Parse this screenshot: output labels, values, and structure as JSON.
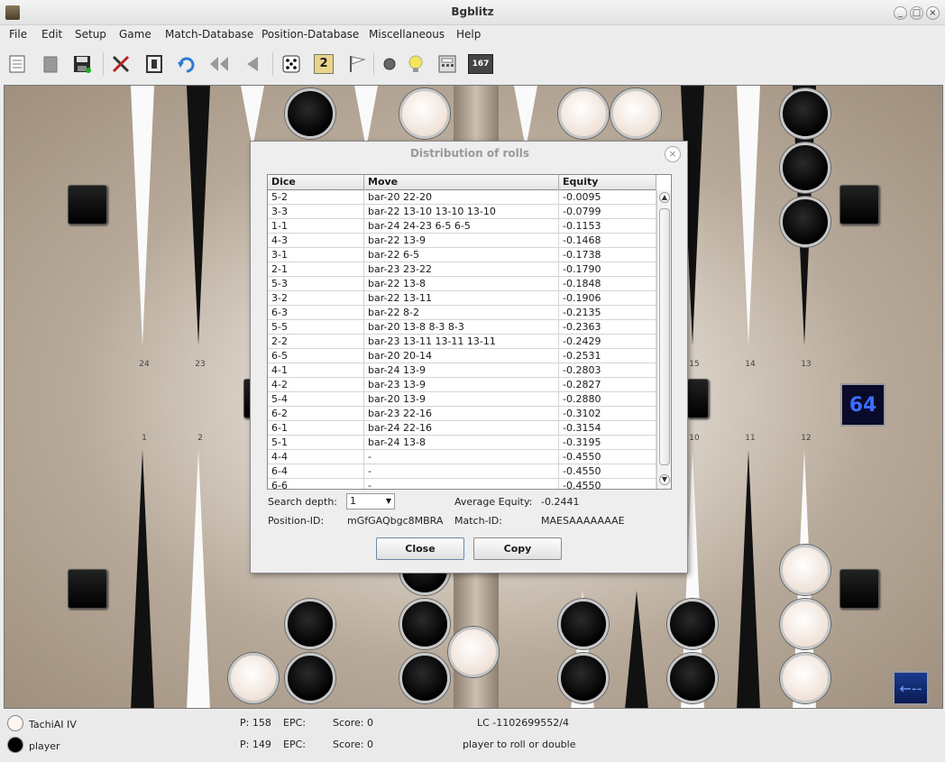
{
  "window": {
    "title": "Bgblitz",
    "minimize": "_",
    "maximize": "□",
    "close": "×"
  },
  "menu": [
    "File",
    "Edit",
    "Setup",
    "Game",
    "Match-Database",
    "Position-Database",
    "Miscellaneous",
    "Help"
  ],
  "toolbar": {
    "dice_value": "2",
    "counter": "167"
  },
  "board": {
    "top_point_labels": [
      "24",
      "23",
      "15",
      "14",
      "13"
    ],
    "bottom_point_labels": [
      "1",
      "2",
      "10",
      "11",
      "12"
    ],
    "cube_value": "64",
    "arrow_label": "←--"
  },
  "dialog": {
    "title": "Distribution of rolls",
    "columns": [
      "Dice",
      "Move",
      "Equity"
    ],
    "rows": [
      [
        "5-2",
        "bar-20 22-20",
        "-0.0095"
      ],
      [
        "3-3",
        "bar-22 13-10 13-10 13-10",
        "-0.0799"
      ],
      [
        "1-1",
        "bar-24 24-23 6-5 6-5",
        "-0.1153"
      ],
      [
        "4-3",
        "bar-22 13-9",
        "-0.1468"
      ],
      [
        "3-1",
        "bar-22 6-5",
        "-0.1738"
      ],
      [
        "2-1",
        "bar-23 23-22",
        "-0.1790"
      ],
      [
        "5-3",
        "bar-22 13-8",
        "-0.1848"
      ],
      [
        "3-2",
        "bar-22 13-11",
        "-0.1906"
      ],
      [
        "6-3",
        "bar-22 8-2",
        "-0.2135"
      ],
      [
        "5-5",
        "bar-20 13-8 8-3 8-3",
        "-0.2363"
      ],
      [
        "2-2",
        "bar-23 13-11 13-11 13-11",
        "-0.2429"
      ],
      [
        "6-5",
        "bar-20 20-14",
        "-0.2531"
      ],
      [
        "4-1",
        "bar-24 13-9",
        "-0.2803"
      ],
      [
        "4-2",
        "bar-23 13-9",
        "-0.2827"
      ],
      [
        "5-4",
        "bar-20 13-9",
        "-0.2880"
      ],
      [
        "6-2",
        "bar-23 22-16",
        "-0.3102"
      ],
      [
        "6-1",
        "bar-24 22-16",
        "-0.3154"
      ],
      [
        "5-1",
        "bar-24 13-8",
        "-0.3195"
      ],
      [
        "4-4",
        "-",
        "-0.4550"
      ],
      [
        "6-4",
        "-",
        "-0.4550"
      ],
      [
        "6-6",
        "-",
        "-0.4550"
      ]
    ],
    "search_depth_label": "Search depth:",
    "search_depth_value": "1",
    "average_equity_label": "Average Equity:",
    "average_equity_value": "-0.2441",
    "position_id_label": "Position-ID:",
    "position_id_value": "mGfGAQbgc8MBRA",
    "match_id_label": "Match-ID:",
    "match_id_value": "MAESAAAAAAAE",
    "close_button": "Close",
    "copy_button": "Copy"
  },
  "status": {
    "player1_name": "TachiAI IV",
    "player1_pips": "P: 158",
    "player1_epc": "EPC:",
    "player1_score": "Score: 0",
    "player2_name": "player",
    "player2_pips": "P: 149",
    "player2_epc": "EPC:",
    "player2_score": "Score: 0",
    "lc_info": "LC -1102699552/4",
    "message": "player to roll or double"
  }
}
